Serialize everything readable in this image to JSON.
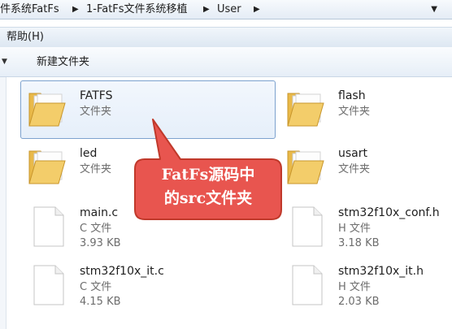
{
  "address": {
    "crumbs": [
      "件系统FatFs",
      "1-FatFs文件系统移植",
      "User"
    ]
  },
  "menu": {
    "help_label": "帮助(H)"
  },
  "toolbar": {
    "new_folder_label": "新建文件夹"
  },
  "files": [
    {
      "name": "FATFS",
      "type": "文件夹",
      "icon": "folder-icon",
      "selected": true
    },
    {
      "name": "flash",
      "type": "文件夹",
      "icon": "folder-icon"
    },
    {
      "name": "led",
      "type": "文件夹",
      "icon": "folder-icon"
    },
    {
      "name": "usart",
      "type": "文件夹",
      "icon": "folder-icon"
    },
    {
      "name": "main.c",
      "type": "C 文件",
      "size": "3.93 KB",
      "icon": "file-icon"
    },
    {
      "name": "stm32f10x_conf.h",
      "type": "H 文件",
      "size": "3.18 KB",
      "icon": "file-icon"
    },
    {
      "name": "stm32f10x_it.c",
      "type": "C 文件",
      "size": "4.15 KB",
      "icon": "file-icon"
    },
    {
      "name": "stm32f10x_it.h",
      "type": "H 文件",
      "size": "2.03 KB",
      "icon": "file-icon"
    }
  ],
  "callout": {
    "line1": "FatFs源码中",
    "line2": "的src文件夹"
  },
  "colors": {
    "callout_fill": "#e8554f",
    "callout_border": "#c0392b",
    "folder": "#f3cd6a"
  }
}
